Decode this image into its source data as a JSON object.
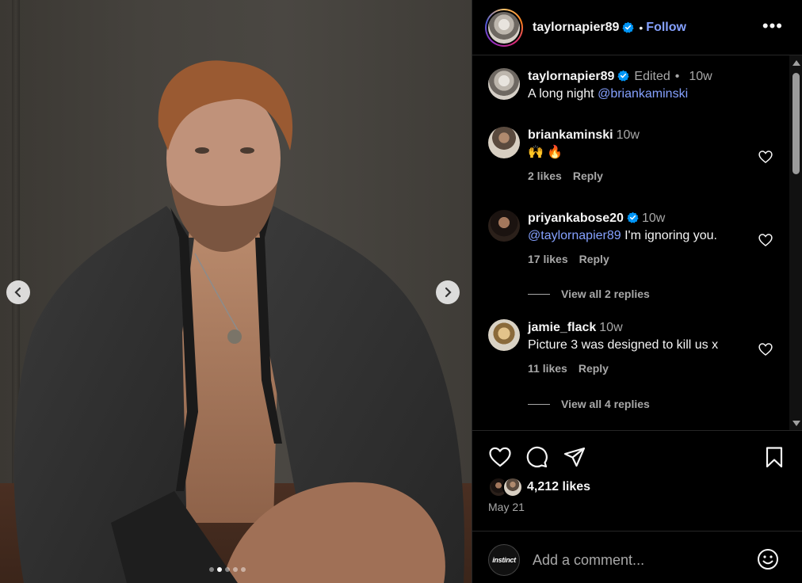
{
  "post": {
    "author": "taylornapier89",
    "follow_label": "Follow",
    "separator": "•",
    "more_label": "•••",
    "carousel": {
      "slide_count": 5,
      "active_index": 1
    }
  },
  "caption": {
    "username": "taylornapier89",
    "edited_label": "Edited",
    "separator": "•",
    "time": "10w",
    "text": "A long night ",
    "mention": "@briankaminski"
  },
  "comments": [
    {
      "username": "briankaminski",
      "time": "10w",
      "text": "🙌 🔥",
      "likes": "2 likes",
      "reply_label": "Reply"
    },
    {
      "username": "priyankabose20",
      "verified": true,
      "time": "10w",
      "mention": "@taylornapier89",
      "text": " I'm ignoring you.",
      "likes": "17 likes",
      "reply_label": "Reply",
      "view_replies": "View all 2 replies"
    },
    {
      "username": "jamie_flack",
      "time": "10w",
      "text": "Picture 3 was designed to kill us x",
      "likes": "11 likes",
      "reply_label": "Reply",
      "view_replies": "View all 4 replies"
    }
  ],
  "footer": {
    "likes": "4,212 likes",
    "date": "May 21",
    "viewer_avatar_text": "instinct",
    "comment_placeholder": "Add a comment..."
  },
  "colors": {
    "accent": "#85a1ff",
    "verified": "#0095f6",
    "secondary_text": "#a8a8a8",
    "background": "#000000"
  },
  "icons": [
    "chevron-left-icon",
    "chevron-right-icon",
    "verified-badge-icon",
    "more-options-icon",
    "heart-icon",
    "comment-icon",
    "share-icon",
    "bookmark-icon",
    "emoji-icon"
  ]
}
